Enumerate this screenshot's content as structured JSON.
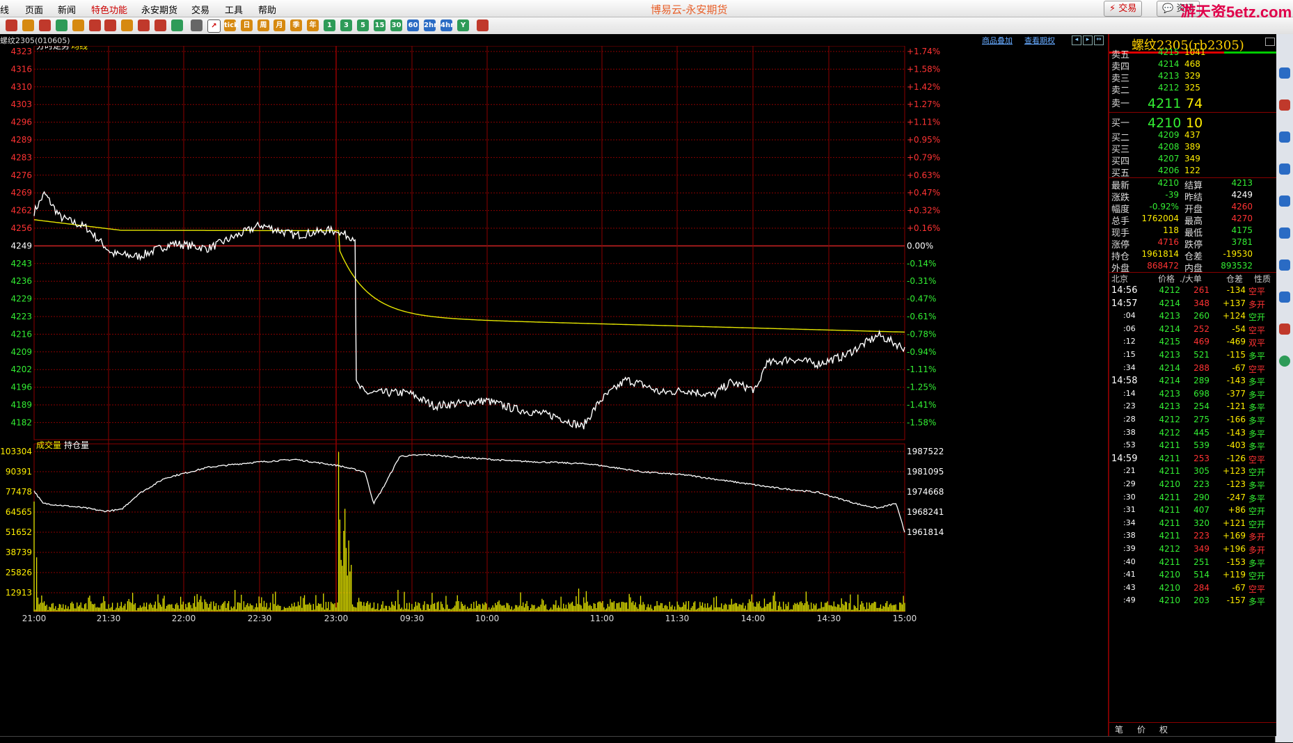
{
  "menu": [
    "线",
    "页面",
    "新闻",
    "特色功能",
    "永安期货",
    "交易",
    "工具",
    "帮助"
  ],
  "app_title": "博易云-永安期货",
  "buttons": {
    "trade": "⚡ 交易",
    "info": "💬 资讯"
  },
  "watermark": "游天资5etz.com",
  "toolbar_icons": [
    "home-icon",
    "folder-icon",
    "ticker-icon",
    "refresh-icon",
    "zoom-in-icon",
    "zoom-out-icon",
    "window-icon",
    "pen-icon",
    "draw-icon",
    "filter-icon",
    "indicator-icon",
    "list-icon",
    "timeshare-icon",
    "tick-icon",
    "day-icon",
    "week-icon",
    "month-icon",
    "quarter-icon",
    "year-icon",
    "min1-icon",
    "min3-icon",
    "min5-icon",
    "min15-icon",
    "min30-icon",
    "min60-icon",
    "h2-icon",
    "h4-icon",
    "custom-icon",
    "calc-icon"
  ],
  "toolbar_labels": [
    "",
    "",
    "",
    "",
    "",
    "",
    "",
    "",
    "",
    "",
    "",
    "",
    "",
    "tick",
    "日",
    "周",
    "月",
    "季",
    "年",
    "1",
    "3",
    "5",
    "15",
    "30",
    "60",
    "2hr",
    "4hr",
    "Y",
    ""
  ],
  "instrument_code": "螺纹2305(010605)",
  "links": {
    "overlay": "商品叠加",
    "options": "查看期权"
  },
  "chart": {
    "title1": "分时走势",
    "title2": "均线",
    "price_ticks": [
      "4323",
      "4316",
      "4310",
      "4303",
      "4296",
      "4289",
      "4283",
      "4276",
      "4269",
      "4262",
      "4256",
      "4249",
      "4243",
      "4236",
      "4229",
      "4223",
      "4216",
      "4209",
      "4202",
      "4196",
      "4189",
      "4182"
    ],
    "pct_ticks": [
      "+1.74%",
      "+1.58%",
      "+1.42%",
      "+1.27%",
      "+1.11%",
      "+0.95%",
      "+0.79%",
      "+0.63%",
      "+0.47%",
      "+0.32%",
      "+0.16%",
      "0.00%",
      "-0.14%",
      "-0.31%",
      "-0.47%",
      "-0.61%",
      "-0.78%",
      "-0.94%",
      "-1.11%",
      "-1.25%",
      "-1.41%",
      "-1.58%"
    ],
    "vol_title1": "成交量",
    "vol_title2": "持仓量",
    "vol_ticks": [
      "103304",
      "90391",
      "77478",
      "64565",
      "51652",
      "38739",
      "25826",
      "12913"
    ],
    "oi_ticks": [
      "1987522",
      "1981095",
      "1974668",
      "1968241",
      "1961814"
    ],
    "time_ticks": [
      "21:00",
      "21:30",
      "22:00",
      "22:30",
      "23:00",
      "09:30",
      "10:00",
      "11:00",
      "11:30",
      "14:00",
      "14:30",
      "15:00"
    ],
    "colors": {
      "price": "#ffffff",
      "avg": "#e6e600",
      "up": "#ff3333",
      "down": "#33ee33",
      "grid": "#8b0000",
      "volume": "#e6e600",
      "oi": "#ffffff"
    }
  },
  "quote": {
    "title": "螺纹2305(rb2305)",
    "asks": [
      {
        "label": "卖五",
        "price": "4215",
        "vol": "1041"
      },
      {
        "label": "卖四",
        "price": "4214",
        "vol": "468"
      },
      {
        "label": "卖三",
        "price": "4213",
        "vol": "329"
      },
      {
        "label": "卖二",
        "price": "4212",
        "vol": "325"
      },
      {
        "label": "卖一",
        "price": "4211",
        "vol": "74"
      }
    ],
    "bids": [
      {
        "label": "买一",
        "price": "4210",
        "vol": "10"
      },
      {
        "label": "买二",
        "price": "4209",
        "vol": "437"
      },
      {
        "label": "买三",
        "price": "4208",
        "vol": "389"
      },
      {
        "label": "买四",
        "price": "4207",
        "vol": "349"
      },
      {
        "label": "买五",
        "price": "4206",
        "vol": "122"
      }
    ],
    "stats": [
      {
        "l1": "最新",
        "v1": "4210",
        "c1": "#33ee33",
        "l2": "结算",
        "v2": "4213",
        "c2": "#33ee33"
      },
      {
        "l1": "涨跌",
        "v1": "-39",
        "c1": "#33ee33",
        "l2": "昨结",
        "v2": "4249",
        "c2": "#ffffff"
      },
      {
        "l1": "幅度",
        "v1": "-0.92%",
        "c1": "#33ee33",
        "l2": "开盘",
        "v2": "4260",
        "c2": "#ff3333"
      },
      {
        "l1": "总手",
        "v1": "1762004",
        "c1": "#ffee00",
        "l2": "最高",
        "v2": "4270",
        "c2": "#ff3333"
      },
      {
        "l1": "现手",
        "v1": "118",
        "c1": "#ffee00",
        "l2": "最低",
        "v2": "4175",
        "c2": "#33ee33"
      },
      {
        "l1": "涨停",
        "v1": "4716",
        "c1": "#ff3333",
        "l2": "跌停",
        "v2": "3781",
        "c2": "#33ee33"
      },
      {
        "l1": "持仓",
        "v1": "1961814",
        "c1": "#ffee00",
        "l2": "仓差",
        "v2": "-19530",
        "c2": "#ffee00"
      },
      {
        "l1": "外盘",
        "v1": "868472",
        "c1": "#ff3333",
        "l2": "内盘",
        "v2": "893532",
        "c2": "#33ee33"
      }
    ],
    "ticks_header": {
      "time": "北京",
      "price": "价格",
      "vol": "./大单",
      "oi": "仓差",
      "type": "性质"
    },
    "ticks": [
      {
        "t": "14:56",
        "p": "4212",
        "v": "261",
        "vc": "#ff3333",
        "d": "-134",
        "ty": "空平",
        "tc": "#ff3333"
      },
      {
        "t": "14:57",
        "p": "4214",
        "v": "348",
        "vc": "#ff3333",
        "d": "+137",
        "ty": "多开",
        "tc": "#ff3333"
      },
      {
        "t": ":04",
        "p": "4213",
        "v": "260",
        "vc": "#33ee33",
        "d": "+124",
        "ty": "空开",
        "tc": "#33ee33"
      },
      {
        "t": ":06",
        "p": "4214",
        "v": "252",
        "vc": "#ff3333",
        "d": "-54",
        "ty": "空平",
        "tc": "#ff3333"
      },
      {
        "t": ":12",
        "p": "4215",
        "v": "469",
        "vc": "#ff3333",
        "d": "-469",
        "ty": "双平",
        "tc": "#ff3333"
      },
      {
        "t": ":15",
        "p": "4213",
        "v": "521",
        "vc": "#33ee33",
        "d": "-115",
        "ty": "多平",
        "tc": "#33ee33"
      },
      {
        "t": ":34",
        "p": "4214",
        "v": "288",
        "vc": "#ff3333",
        "d": "-67",
        "ty": "空平",
        "tc": "#ff3333"
      },
      {
        "t": "14:58",
        "p": "4214",
        "v": "289",
        "vc": "#33ee33",
        "d": "-143",
        "ty": "多平",
        "tc": "#33ee33"
      },
      {
        "t": ":14",
        "p": "4213",
        "v": "698",
        "vc": "#33ee33",
        "d": "-377",
        "ty": "多平",
        "tc": "#33ee33"
      },
      {
        "t": ":23",
        "p": "4213",
        "v": "254",
        "vc": "#33ee33",
        "d": "-121",
        "ty": "多平",
        "tc": "#33ee33"
      },
      {
        "t": ":28",
        "p": "4212",
        "v": "275",
        "vc": "#33ee33",
        "d": "-166",
        "ty": "多平",
        "tc": "#33ee33"
      },
      {
        "t": ":38",
        "p": "4212",
        "v": "445",
        "vc": "#33ee33",
        "d": "-143",
        "ty": "多平",
        "tc": "#33ee33"
      },
      {
        "t": ":53",
        "p": "4211",
        "v": "539",
        "vc": "#33ee33",
        "d": "-403",
        "ty": "多平",
        "tc": "#33ee33"
      },
      {
        "t": "14:59",
        "p": "4211",
        "v": "253",
        "vc": "#ff3333",
        "d": "-126",
        "ty": "空平",
        "tc": "#ff3333"
      },
      {
        "t": ":21",
        "p": "4211",
        "v": "305",
        "vc": "#33ee33",
        "d": "+123",
        "ty": "空开",
        "tc": "#33ee33"
      },
      {
        "t": ":29",
        "p": "4210",
        "v": "223",
        "vc": "#33ee33",
        "d": "-123",
        "ty": "多平",
        "tc": "#33ee33"
      },
      {
        "t": ":30",
        "p": "4211",
        "v": "290",
        "vc": "#33ee33",
        "d": "-247",
        "ty": "多平",
        "tc": "#33ee33"
      },
      {
        "t": ":31",
        "p": "4211",
        "v": "407",
        "vc": "#33ee33",
        "d": "+86",
        "ty": "空开",
        "tc": "#33ee33"
      },
      {
        "t": ":34",
        "p": "4211",
        "v": "320",
        "vc": "#33ee33",
        "d": "+121",
        "ty": "空开",
        "tc": "#33ee33"
      },
      {
        "t": ":38",
        "p": "4211",
        "v": "223",
        "vc": "#ff3333",
        "d": "+169",
        "ty": "多开",
        "tc": "#ff3333"
      },
      {
        "t": ":39",
        "p": "4212",
        "v": "349",
        "vc": "#ff3333",
        "d": "+196",
        "ty": "多开",
        "tc": "#ff3333"
      },
      {
        "t": ":40",
        "p": "4211",
        "v": "251",
        "vc": "#33ee33",
        "d": "-153",
        "ty": "多平",
        "tc": "#33ee33"
      },
      {
        "t": ":41",
        "p": "4210",
        "v": "514",
        "vc": "#33ee33",
        "d": "+119",
        "ty": "空开",
        "tc": "#33ee33"
      },
      {
        "t": ":43",
        "p": "4210",
        "v": "284",
        "vc": "#ff3333",
        "d": "-67",
        "ty": "空平",
        "tc": "#ff3333"
      },
      {
        "t": ":49",
        "p": "4210",
        "v": "203",
        "vc": "#33ee33",
        "d": "-157",
        "ty": "多平",
        "tc": "#33ee33"
      }
    ],
    "tabs": [
      "笔",
      "价",
      "权"
    ]
  }
}
